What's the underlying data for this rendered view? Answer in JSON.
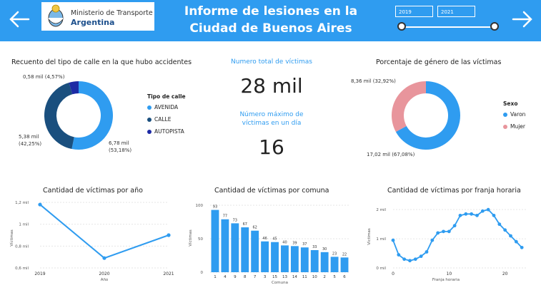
{
  "header": {
    "logo_line1": "Ministerio de Transporte",
    "logo_line2": "Argentina",
    "title_line1": "Informe de lesiones en la",
    "title_line2": "Ciudad de Buenos Aires",
    "date_from": "2019",
    "date_to": "2021",
    "slider_start": 0,
    "slider_end": 1,
    "colors": {
      "bar": "#2f9cf0",
      "text": "#ffffff"
    }
  },
  "street_type": {
    "title": "Recuento del tipo de calle en la que hubo accidentes",
    "legend_title": "Tipo de calle",
    "legend": [
      "AVENIDA",
      "CALLE",
      "AUTOPISTA"
    ],
    "labels": [
      "6,78 mil",
      "(53,18%)",
      "5,38 mil",
      "(42,25%)",
      "0,58 mil (4,57%)"
    ]
  },
  "kpi": {
    "total_label": "Numero total de víctimas",
    "total_value": "28 mil",
    "max_label_1": "Número máximo de",
    "max_label_2": "víctimas en un día",
    "max_value": "16"
  },
  "gender": {
    "title": "Porcentaje de género de las víctimas",
    "legend_title": "Sexo",
    "legend": [
      "Varon",
      "Mujer"
    ],
    "labels": [
      "8,36 mil (32,92%)",
      "17,02 mil (67,08%)"
    ]
  },
  "year_chart": {
    "title": "Cantidad de víctimas por año",
    "ylabel": "Víctimas",
    "xlabel": "Año",
    "yticks": [
      "1,2 mil",
      "1 mil",
      "0,8 mil",
      "0,6 mil"
    ]
  },
  "comuna_chart": {
    "title": "Cantidad de víctimas por comuna",
    "ylabel": "Víctimas",
    "xlabel": "Comuna",
    "yticks": [
      "100",
      "50",
      "0"
    ]
  },
  "hour_chart": {
    "title": "Cantidad de víctimas por franja horaria",
    "ylabel": "Víctimas",
    "xlabel": "Franja horaria",
    "yticks": [
      "2 mil",
      "1 mil",
      "0 mil"
    ],
    "xticks": [
      "0",
      "10",
      "20"
    ]
  },
  "chart_data": [
    {
      "type": "pie",
      "title": "Recuento del tipo de calle en la que hubo accidentes",
      "categories": [
        "AVENIDA",
        "CALLE",
        "AUTOPISTA"
      ],
      "values": [
        6780,
        5380,
        580
      ],
      "percent": [
        53.18,
        42.25,
        4.57
      ],
      "colors": [
        "#2f9cf0",
        "#1a4f7e",
        "#1d2aa5"
      ]
    },
    {
      "type": "pie",
      "title": "Porcentaje de género de las víctimas",
      "categories": [
        "Varon",
        "Mujer"
      ],
      "values": [
        17020,
        8360
      ],
      "percent": [
        67.08,
        32.92
      ],
      "colors": [
        "#2f9cf0",
        "#e8959c"
      ]
    },
    {
      "type": "line",
      "title": "Cantidad de víctimas por año",
      "xlabel": "Año",
      "ylabel": "Víctimas",
      "x": [
        "2019",
        "2020",
        "2021"
      ],
      "values": [
        1180,
        690,
        900
      ],
      "ylim": [
        600,
        1200
      ]
    },
    {
      "type": "bar",
      "title": "Cantidad de víctimas por comuna",
      "xlabel": "Comuna",
      "ylabel": "Víctimas",
      "categories": [
        "1",
        "4",
        "9",
        "8",
        "7",
        "3",
        "15",
        "13",
        "14",
        "11",
        "10",
        "2",
        "5",
        "6"
      ],
      "values": [
        93,
        79,
        73,
        67,
        62,
        46,
        45,
        40,
        39,
        37,
        33,
        30,
        23,
        22
      ],
      "labels": [
        "93",
        "77",
        "73",
        "67",
        "62",
        "46",
        "45",
        "40",
        "39",
        "37",
        "33",
        "30",
        "23",
        "22"
      ],
      "ylim": [
        0,
        100
      ]
    },
    {
      "type": "line",
      "title": "Cantidad de víctimas por franja horaria",
      "xlabel": "Franja horaria",
      "ylabel": "Víctimas",
      "x": [
        0,
        1,
        2,
        3,
        4,
        5,
        6,
        7,
        8,
        9,
        10,
        11,
        12,
        13,
        14,
        15,
        16,
        17,
        18,
        19,
        20,
        21,
        22,
        23
      ],
      "values": [
        950,
        450,
        300,
        250,
        300,
        400,
        550,
        950,
        1200,
        1250,
        1250,
        1450,
        1800,
        1850,
        1850,
        1800,
        1950,
        2000,
        1800,
        1500,
        1300,
        1100,
        900,
        700
      ],
      "ylim": [
        0,
        2200
      ]
    }
  ]
}
